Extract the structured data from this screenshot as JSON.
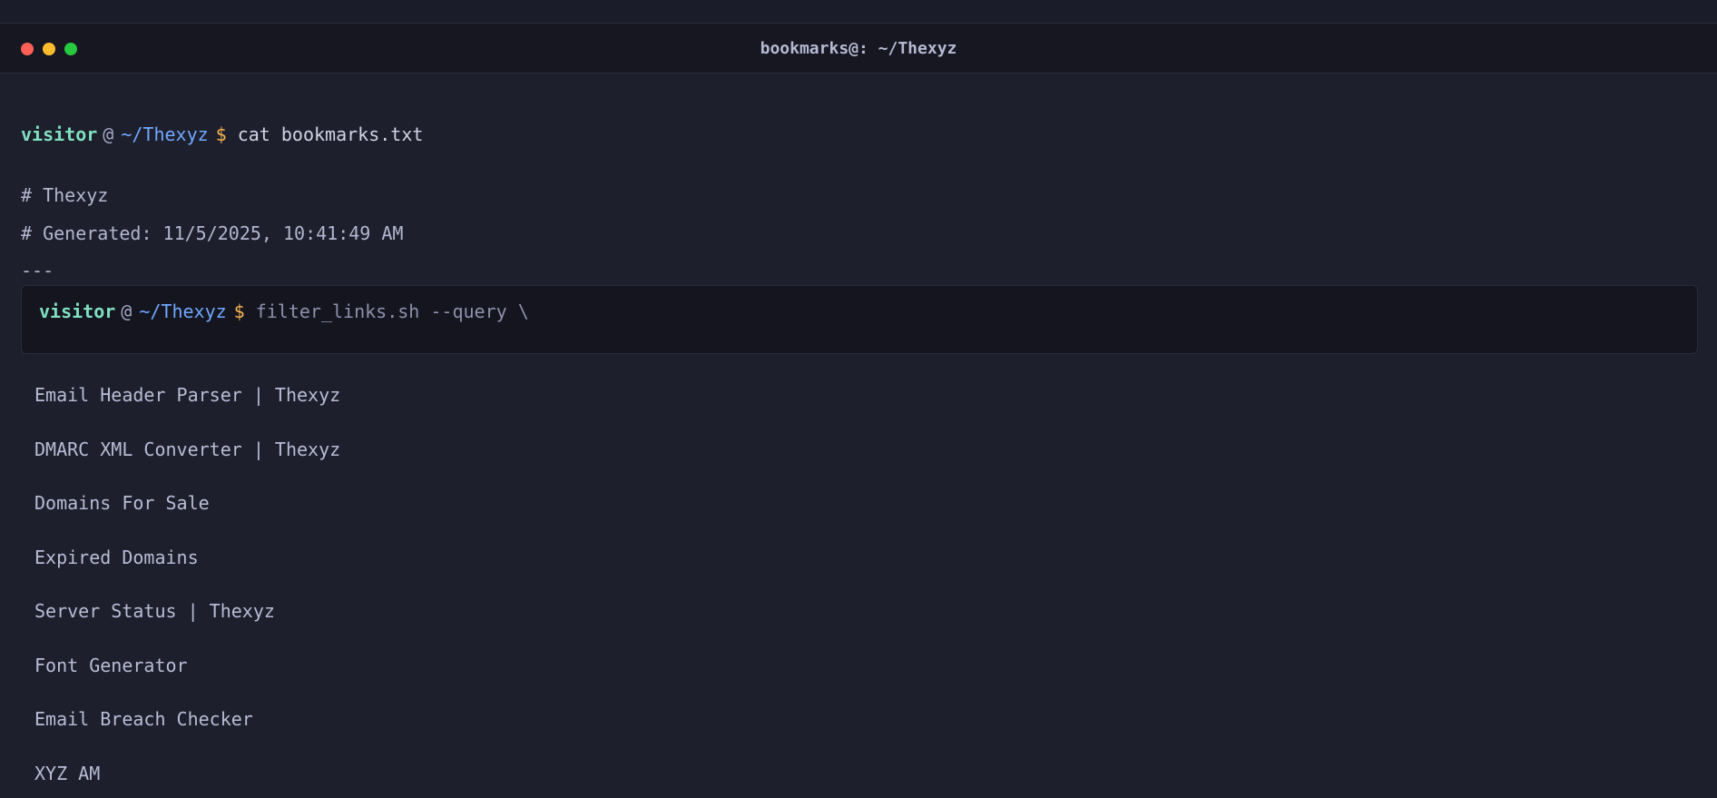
{
  "window": {
    "title": "bookmarks@: ~/Thexyz"
  },
  "prompt": {
    "user": "visitor",
    "at": "@",
    "path": "~/Thexyz",
    "symbol": "$",
    "command": "cat bookmarks.txt"
  },
  "header": {
    "site": "# Thexyz",
    "generated": "# Generated: 11/5/2025, 10:41:49 AM",
    "separator": "---"
  },
  "filter": {
    "user": "visitor",
    "at": "@",
    "path": "~/Thexyz",
    "symbol": "$",
    "value": "filter_links.sh --query \\"
  },
  "links": [
    "Email Header Parser | Thexyz",
    "DMARC XML Converter | Thexyz",
    "Domains For Sale",
    "Expired Domains",
    "Server Status | Thexyz",
    "Font Generator",
    "Email Breach Checker",
    "XYZ AM"
  ],
  "colors": {
    "user": "#7fe0c0",
    "path": "#6fa8ff",
    "symbol": "#f7b452",
    "background": "#1e1f2c"
  }
}
